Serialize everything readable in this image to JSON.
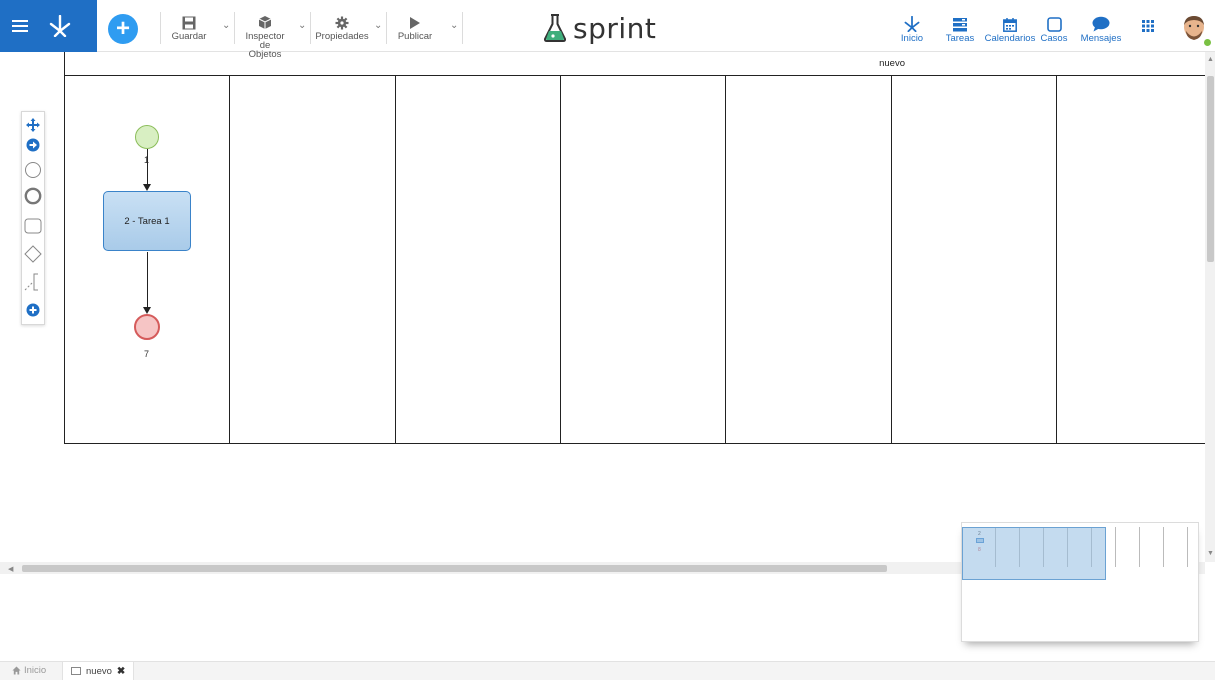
{
  "toolbar": {
    "save_label": "Guardar",
    "inspector_label_line1": "Inspector de",
    "inspector_label_line2": "Objetos",
    "properties_label": "Propiedades",
    "publish_label": "Publicar"
  },
  "brand": {
    "name": "sprint",
    "accent": "#1f6fc5"
  },
  "nav": {
    "home_label": "Inicio",
    "tasks_label": "Tareas",
    "calendars_label": "Calendarios",
    "cases_label": "Casos",
    "messages_label": "Mensajes"
  },
  "diagram": {
    "pool_title": "nuevo",
    "start_event_label": "1",
    "task_label": "2 - Tarea 1",
    "end_event_label": "7"
  },
  "minimap": {
    "task_label": "2",
    "end_label": "8"
  },
  "tabs": {
    "home_label": "Inicio",
    "active_label": "nuevo"
  }
}
